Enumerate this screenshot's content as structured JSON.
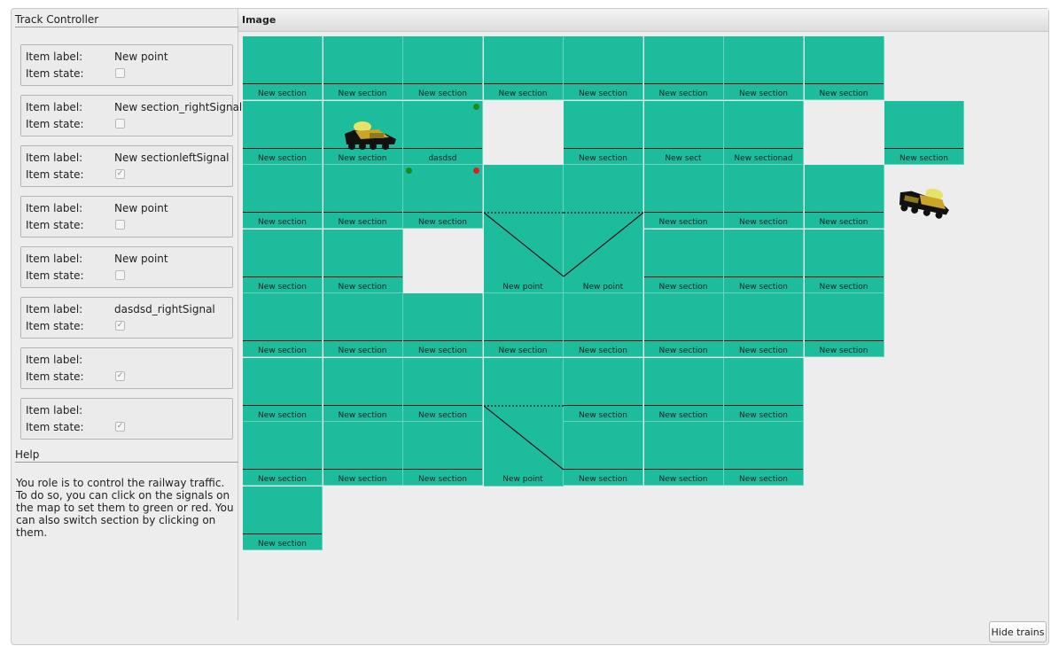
{
  "panel": {
    "title": "Track Controller"
  },
  "help": {
    "title": "Help",
    "text": "You role is to control the railway traffic. To do so, you can click on the signals on the map to set them to green or red. You can also switch section by clicking on them."
  },
  "items": [
    {
      "label_caption": "Item label:",
      "label_value": "New point",
      "state_caption": "Item state:",
      "checked": false
    },
    {
      "label_caption": "Item label:",
      "label_value": "New section_rightSignal",
      "state_caption": "Item state:",
      "checked": false
    },
    {
      "label_caption": "Item label:",
      "label_value": "New sectionleftSignal",
      "state_caption": "Item state:",
      "checked": true
    },
    {
      "label_caption": "Item label:",
      "label_value": "New point",
      "state_caption": "Item state:",
      "checked": false
    },
    {
      "label_caption": "Item label:",
      "label_value": "New point",
      "state_caption": "Item state:",
      "checked": false
    },
    {
      "label_caption": "Item label:",
      "label_value": "dasdsd_rightSignal",
      "state_caption": "Item state:",
      "checked": true
    },
    {
      "label_caption": "Item label:",
      "label_value": "",
      "state_caption": "Item state:",
      "checked": true
    },
    {
      "label_caption": "Item label:",
      "label_value": "",
      "state_caption": "Item state:",
      "checked": true
    }
  ],
  "image_panel": {
    "title": "Image"
  },
  "grid": {
    "colors": {
      "section": "#1dbc9c",
      "track": "#111111",
      "signal_green": "#1e8a1e",
      "signal_red": "#d8201c"
    },
    "rows": [
      [
        {
          "type": "section",
          "label": "New section"
        },
        {
          "type": "section",
          "label": "New section"
        },
        {
          "type": "section",
          "label": "New section"
        },
        {
          "type": "section",
          "label": "New section"
        },
        {
          "type": "section",
          "label": "New section"
        },
        {
          "type": "section",
          "label": "New section"
        },
        {
          "type": "section",
          "label": "New section"
        },
        {
          "type": "section",
          "label": "New section"
        },
        null
      ],
      [
        {
          "type": "section",
          "label": "New section"
        },
        {
          "type": "section",
          "label": "New section"
        },
        {
          "type": "section",
          "label": "dasdsd",
          "signals": [
            "green-right"
          ]
        },
        null,
        {
          "type": "section",
          "label": "New section"
        },
        {
          "type": "section",
          "label": "New sect"
        },
        {
          "type": "section",
          "label": "New sectionad"
        },
        null,
        {
          "type": "section",
          "label": "New section"
        }
      ],
      [
        {
          "type": "section",
          "label": "New section"
        },
        {
          "type": "section",
          "label": "New section"
        },
        {
          "type": "section",
          "label": "New section",
          "signals": [
            "green-left",
            "red-right"
          ]
        },
        {
          "type": "point",
          "label": "New point",
          "shape": "down-right",
          "top_dotted": true
        },
        {
          "type": "point",
          "label": "New point",
          "shape": "up-right",
          "top_dotted": true
        },
        {
          "type": "section",
          "label": "New section"
        },
        {
          "type": "section",
          "label": "New section"
        },
        {
          "type": "section",
          "label": "New section"
        },
        null
      ],
      [
        {
          "type": "section",
          "label": "New section"
        },
        {
          "type": "section",
          "label": "New section"
        },
        null,
        "merged-up",
        "merged-up",
        {
          "type": "section",
          "label": "New section"
        },
        {
          "type": "section",
          "label": "New section"
        },
        {
          "type": "section",
          "label": "New section"
        },
        null
      ],
      [
        {
          "type": "section",
          "label": "New section"
        },
        {
          "type": "section",
          "label": "New section"
        },
        {
          "type": "section",
          "label": "New section"
        },
        {
          "type": "section",
          "label": "New section"
        },
        {
          "type": "section",
          "label": "New section"
        },
        {
          "type": "section",
          "label": "New section"
        },
        {
          "type": "section",
          "label": "New section"
        },
        {
          "type": "section",
          "label": "New section"
        },
        null
      ],
      [
        {
          "type": "section",
          "label": "New section"
        },
        {
          "type": "section",
          "label": "New section"
        },
        {
          "type": "section",
          "label": "New section"
        },
        {
          "type": "point",
          "label": "New point",
          "shape": "down-right-single",
          "top_dotted": true
        },
        {
          "type": "section",
          "label": "New section"
        },
        {
          "type": "section",
          "label": "New section"
        },
        {
          "type": "section",
          "label": "New section"
        },
        null,
        null
      ],
      [
        {
          "type": "section",
          "label": "New section"
        },
        {
          "type": "section",
          "label": "New section"
        },
        {
          "type": "section",
          "label": "New section"
        },
        "merged-up",
        {
          "type": "section",
          "label": "New section"
        },
        {
          "type": "section",
          "label": "New section"
        },
        {
          "type": "section",
          "label": "New section"
        },
        null,
        null
      ],
      [
        {
          "type": "section",
          "label": "New section"
        },
        null,
        null,
        null,
        null,
        null,
        null,
        null,
        null
      ]
    ]
  },
  "trains": [
    {
      "name": "train-1"
    },
    {
      "name": "train-2"
    }
  ],
  "buttons": {
    "hide_trains": "Hide trains"
  }
}
